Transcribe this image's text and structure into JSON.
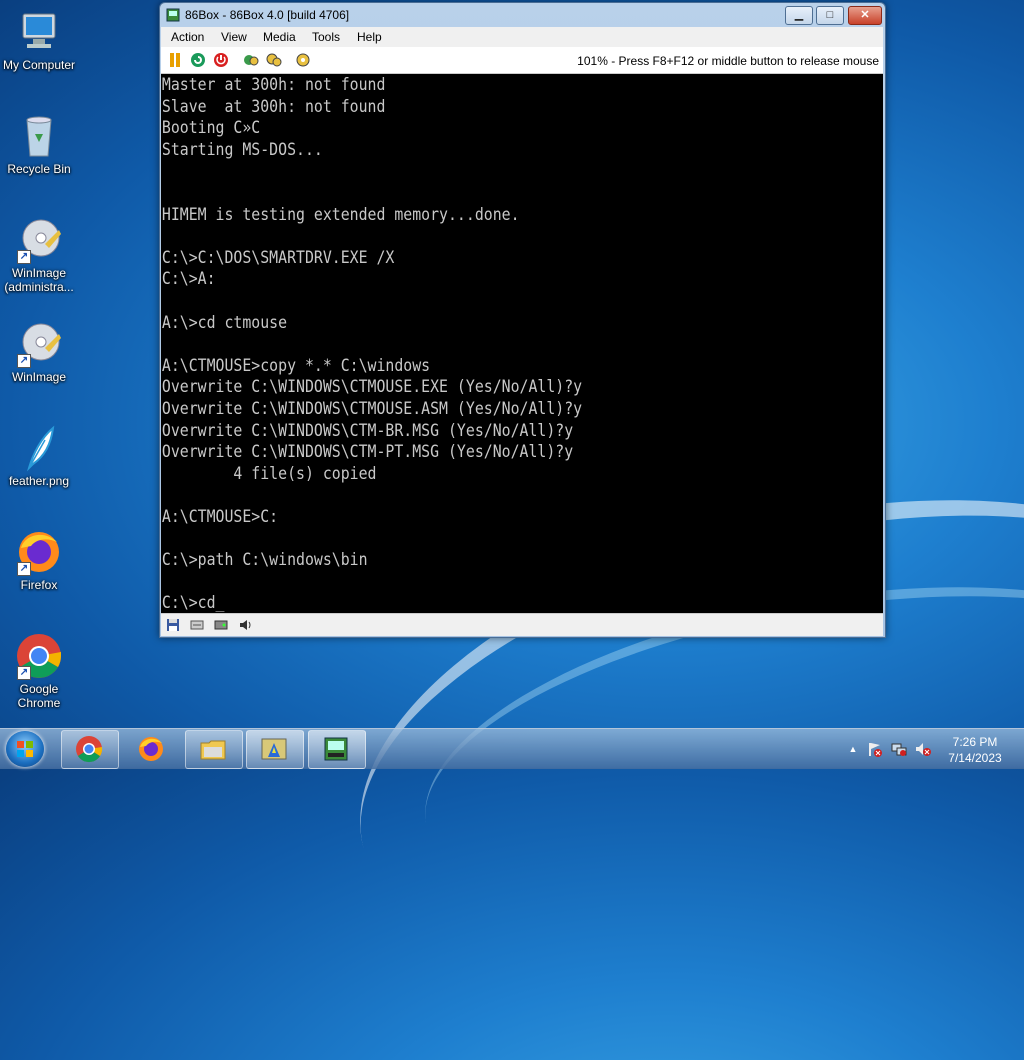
{
  "desktop": {
    "icons": [
      {
        "label": "My Computer"
      },
      {
        "label": "Recycle Bin"
      },
      {
        "label": "WinImage (administra..."
      },
      {
        "label": "WinImage"
      },
      {
        "label": "feather.png"
      },
      {
        "label": "Firefox"
      },
      {
        "label": "Google Chrome"
      }
    ]
  },
  "window": {
    "title": "86Box - 86Box 4.0 [build 4706]",
    "menu": [
      "Action",
      "View",
      "Media",
      "Tools",
      "Help"
    ],
    "toolbar_status": "101% - Press F8+F12 or middle button to release mouse",
    "controls": {
      "minimize": "▁",
      "maximize": "□",
      "close": "✕"
    }
  },
  "terminal": {
    "text": "Master at 300h: not found\nSlave  at 300h: not found\nBooting C»C\nStarting MS-DOS...\n\n\nHIMEM is testing extended memory...done.\n\nC:\\>C:\\DOS\\SMARTDRV.EXE /X\nC:\\>A:\n\nA:\\>cd ctmouse\n\nA:\\CTMOUSE>copy *.* C:\\windows\nOverwrite C:\\WINDOWS\\CTMOUSE.EXE (Yes/No/All)?y\nOverwrite C:\\WINDOWS\\CTMOUSE.ASM (Yes/No/All)?y\nOverwrite C:\\WINDOWS\\CTM-BR.MSG (Yes/No/All)?y\nOverwrite C:\\WINDOWS\\CTM-PT.MSG (Yes/No/All)?y\n        4 file(s) copied\n\nA:\\CTMOUSE>C:\n\nC:\\>path C:\\windows\\bin\n\nC:\\>cd_"
  },
  "taskbar": {
    "clock_time": "7:26 PM",
    "clock_date": "7/14/2023",
    "tray_arrow": "▲"
  },
  "colors": {
    "terminal_text": "#c8c8c8",
    "terminal_bg": "#000000"
  }
}
